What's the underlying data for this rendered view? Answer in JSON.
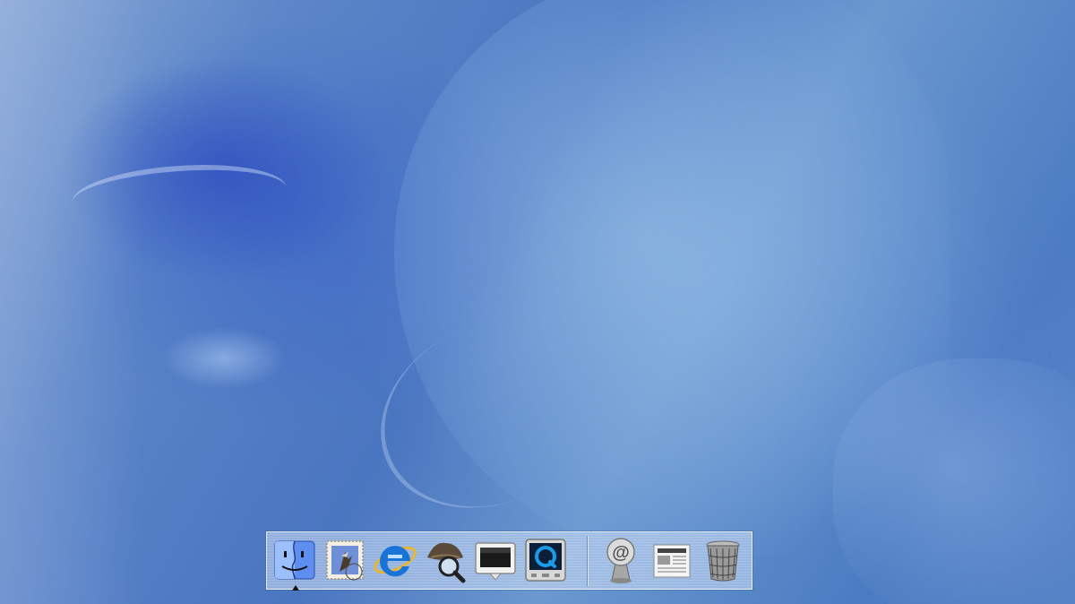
{
  "desktop": {
    "name": "desktop-background"
  },
  "dock": {
    "apps": [
      {
        "id": "finder",
        "icon": "finder-icon",
        "running": true
      },
      {
        "id": "mail",
        "icon": "mail-stamp-icon",
        "running": false
      },
      {
        "id": "internet-explorer",
        "icon": "internet-explorer-icon",
        "running": false
      },
      {
        "id": "sherlock",
        "icon": "sherlock-icon",
        "running": false
      },
      {
        "id": "system-preferences",
        "icon": "system-preferences-icon",
        "running": false
      },
      {
        "id": "quicktime",
        "icon": "quicktime-icon",
        "running": false
      }
    ],
    "docs": [
      {
        "id": "at-sign",
        "icon": "at-sign-icon"
      },
      {
        "id": "news",
        "icon": "newspaper-icon"
      },
      {
        "id": "trash",
        "icon": "trash-icon"
      }
    ],
    "colors": {
      "dock_bg": "#cddef5",
      "ie_blue": "#1a73d6",
      "finder_blue": "#3a6fd8"
    }
  }
}
